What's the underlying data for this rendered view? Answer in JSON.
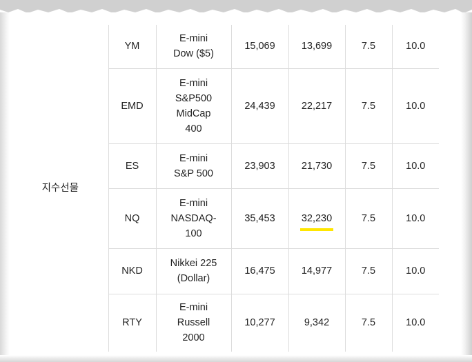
{
  "table": {
    "group_label": "지수선물",
    "rows": [
      {
        "code": "YM",
        "name": [
          "E-mini",
          "Dow ($5)"
        ],
        "col3": "15,069",
        "col4": "13,699",
        "col5": "7.5",
        "col6": "10.0"
      },
      {
        "code": "EMD",
        "name": [
          "E-mini",
          "S&P500",
          "MidCap",
          "400"
        ],
        "col3": "24,439",
        "col4": "22,217",
        "col5": "7.5",
        "col6": "10.0"
      },
      {
        "code": "ES",
        "name": [
          "E-mini",
          "S&P 500"
        ],
        "col3": "23,903",
        "col4": "21,730",
        "col5": "7.5",
        "col6": "10.0"
      },
      {
        "code": "NQ",
        "name": [
          "E-mini",
          "NASDAQ-",
          "100"
        ],
        "col3": "35,453",
        "col4": "32,230",
        "col5": "7.5",
        "col6": "10.0",
        "col4_highlighted": true
      },
      {
        "code": "NKD",
        "name": [
          "Nikkei 225",
          "(Dollar)"
        ],
        "col3": "16,475",
        "col4": "14,977",
        "col5": "7.5",
        "col6": "10.0"
      },
      {
        "code": "RTY",
        "name": [
          "E-mini",
          "Russell",
          "2000"
        ],
        "col3": "10,277",
        "col4": "9,342",
        "col5": "7.5",
        "col6": "10.0"
      }
    ]
  },
  "colors": {
    "highlight": "#ffe600",
    "border": "#dcdcdc"
  }
}
